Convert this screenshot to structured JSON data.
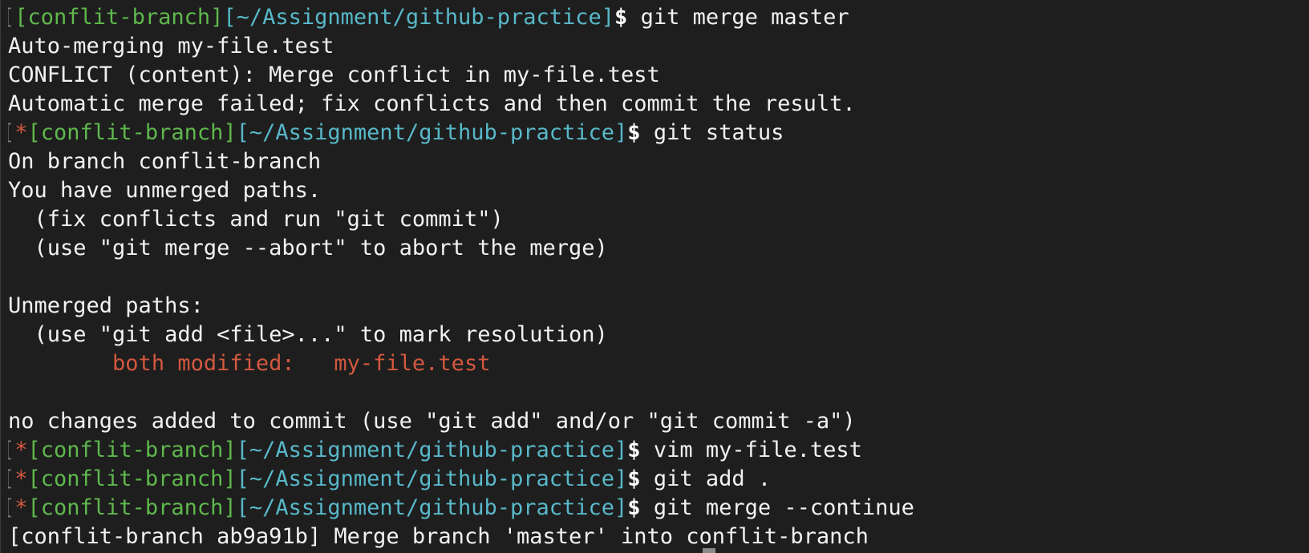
{
  "terminal": {
    "prompt": {
      "branch": "[conflit-branch]",
      "path": "[~/Assignment/github-practice]",
      "symbol": "$",
      "dirty_marker": "*",
      "open_bracket": "["
    },
    "commands": {
      "c1": "git merge master",
      "c2": "git status",
      "c3": "vim my-file.test",
      "c4": "git add .",
      "c5": "git merge --continue"
    },
    "output": {
      "l2": "Auto-merging my-file.test",
      "l3": "CONFLICT (content): Merge conflict in my-file.test",
      "l4": "Automatic merge failed; fix conflicts and then commit the result.",
      "l6": "On branch conflit-branch",
      "l7": "You have unmerged paths.",
      "l8": "  (fix conflicts and run \"git commit\")",
      "l9": "  (use \"git merge --abort\" to abort the merge)",
      "l11": "Unmerged paths:",
      "l12": "  (use \"git add <file>...\" to mark resolution)",
      "l13_indent": "        ",
      "l13_status": "both modified:   my-file.test",
      "l15": "no changes added to commit (use \"git add\" and/or \"git commit -a\")",
      "l19": "[conflit-branch ab9a91b] Merge branch 'master' into conflit-branch"
    },
    "colors": {
      "background": "#1e1e1e",
      "text": "#f2f2f2",
      "branch": "#5fb84d",
      "path": "#58b8c9",
      "marker": "#d2583f"
    }
  }
}
